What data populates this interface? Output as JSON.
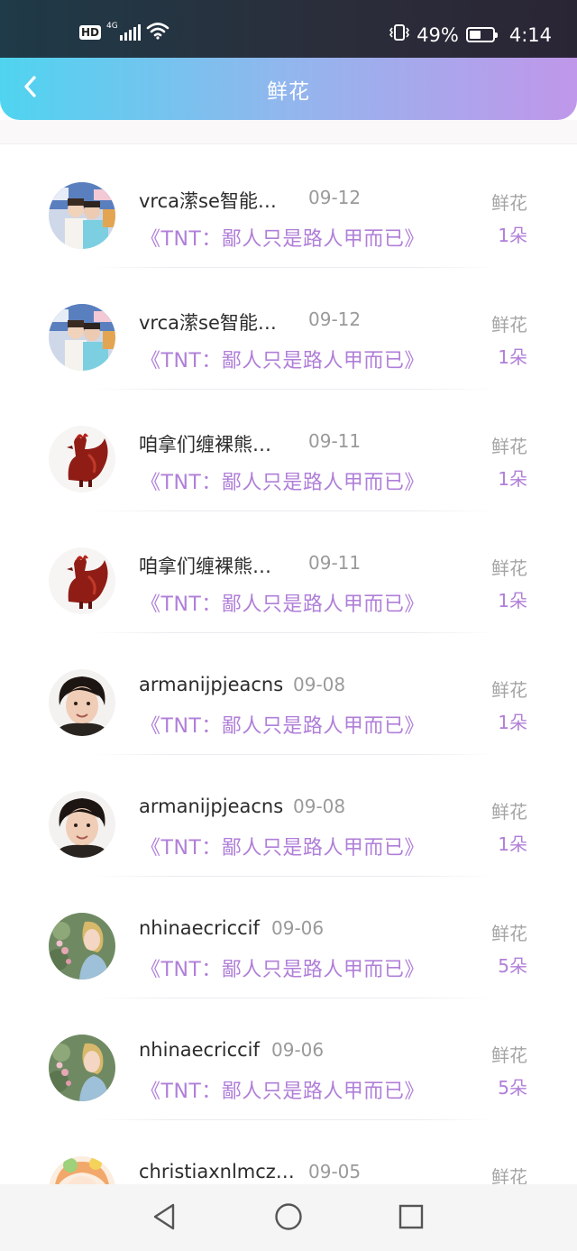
{
  "status_bar": {
    "hd": "HD",
    "network": "4G",
    "battery_percent": "49%",
    "battery_level": 0.49,
    "time": "4:14"
  },
  "header": {
    "title": "鲜花",
    "back_icon": "chevron-left-icon"
  },
  "gift_list": [
    {
      "username": "vrca潆se智能…",
      "date": "09-12",
      "book": "《TNT：鄙人只是路人甲而已》",
      "gift_type": "鲜花",
      "gift_count": "1朵",
      "avatar": "photo-couple"
    },
    {
      "username": "vrca潆se智能…",
      "date": "09-12",
      "book": "《TNT：鄙人只是路人甲而已》",
      "gift_type": "鲜花",
      "gift_count": "1朵",
      "avatar": "photo-couple"
    },
    {
      "username": "咱拿们缠裸熊…",
      "date": "09-11",
      "book": "《TNT：鄙人只是路人甲而已》",
      "gift_type": "鲜花",
      "gift_count": "1朵",
      "avatar": "red-rooster"
    },
    {
      "username": "咱拿们缠裸熊…",
      "date": "09-11",
      "book": "《TNT：鄙人只是路人甲而已》",
      "gift_type": "鲜花",
      "gift_count": "1朵",
      "avatar": "red-rooster"
    },
    {
      "username": "armanijpjeacns",
      "date": "09-08",
      "book": "《TNT：鄙人只是路人甲而已》",
      "gift_type": "鲜花",
      "gift_count": "1朵",
      "avatar": "portrait-man"
    },
    {
      "username": "armanijpjeacns",
      "date": "09-08",
      "book": "《TNT：鄙人只是路人甲而已》",
      "gift_type": "鲜花",
      "gift_count": "1朵",
      "avatar": "portrait-man"
    },
    {
      "username": "nhinaecriccif",
      "date": "09-06",
      "book": "《TNT：鄙人只是路人甲而已》",
      "gift_type": "鲜花",
      "gift_count": "5朵",
      "avatar": "painting-woman"
    },
    {
      "username": "nhinaecriccif",
      "date": "09-06",
      "book": "《TNT：鄙人只是路人甲而已》",
      "gift_type": "鲜花",
      "gift_count": "5朵",
      "avatar": "painting-woman"
    },
    {
      "username": "christiaxnlmcz…",
      "date": "09-05",
      "book": "",
      "gift_type": "鲜花",
      "gift_count": "",
      "avatar": "anime-figure"
    }
  ],
  "nav_bar": {
    "back": "triangle-back-icon",
    "home": "circle-home-icon",
    "recents": "square-recents-icon"
  }
}
